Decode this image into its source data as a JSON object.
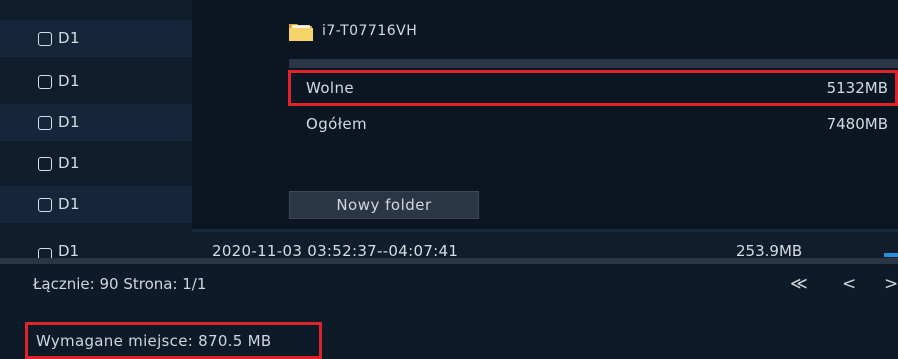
{
  "list": {
    "rows": [
      {
        "label": "D1"
      },
      {
        "label": "D1"
      },
      {
        "label": "D1"
      },
      {
        "label": "D1"
      },
      {
        "label": "D1"
      },
      {
        "label": "D1",
        "time": "2020-11-03 03:52:37--04:07:41",
        "size": "253.9MB"
      }
    ]
  },
  "dialog": {
    "folder_name": "i7-T07716VH",
    "free_label": "Wolne",
    "free_value": "5132MB",
    "total_label": "Ogółem",
    "total_value": "7480MB",
    "new_folder_button": "Nowy folder"
  },
  "footer": {
    "summary": "Łącznie: 90  Strona: 1/1",
    "first_page": "≪",
    "prev_page": "<",
    "next_page": ">",
    "required_space": "Wymagane miejsce: 870.5 MB"
  },
  "colors": {
    "highlight": "#e0232b",
    "folder": "#f2c94c",
    "accent": "#2a8fd8"
  }
}
